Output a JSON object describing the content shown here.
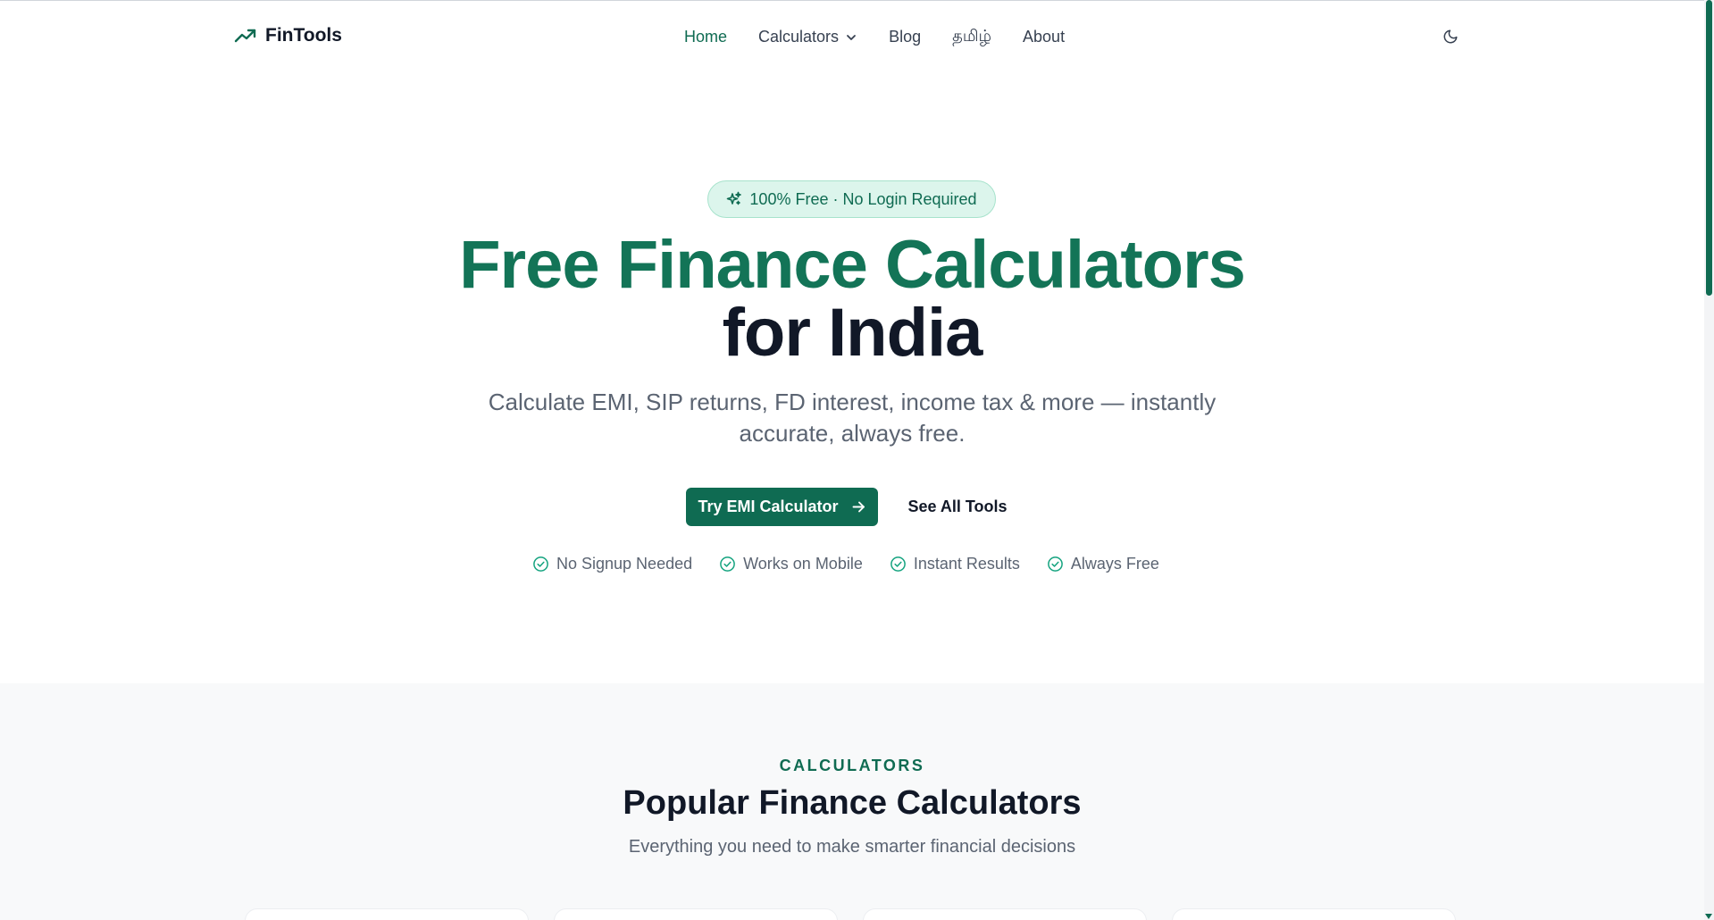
{
  "colors": {
    "brand": "#0f6b52",
    "brand_title": "#137457",
    "badge_bg": "#dcf5ec",
    "text_dark": "#111827",
    "text_muted": "#5b6472",
    "section_bg": "#f8f9fa"
  },
  "nav": {
    "logo_text": "FinTools",
    "logo_icon": "trending-up-icon",
    "links": [
      {
        "label": "Home",
        "active": true
      },
      {
        "label": "Calculators",
        "has_dropdown": true
      },
      {
        "label": "Blog"
      },
      {
        "label": "தமிழ்"
      },
      {
        "label": "About"
      }
    ],
    "theme_toggle_icon": "moon-icon"
  },
  "hero": {
    "badge": "100% Free · No Login Required",
    "badge_icon": "sparkles-icon",
    "title_line1": "Free Finance Calculators",
    "title_line2": "for India",
    "subtitle": "Calculate EMI, SIP returns, FD interest, income tax & more — instantly accurate, always free.",
    "primary_cta": "Try EMI Calculator",
    "secondary_cta": "See All Tools",
    "features": [
      "No Signup Needed",
      "Works on Mobile",
      "Instant Results",
      "Always Free"
    ]
  },
  "calculators_section": {
    "eyebrow": "CALCULATORS",
    "title": "Popular Finance Calculators",
    "subtitle": "Everything you need to make smarter financial decisions"
  }
}
